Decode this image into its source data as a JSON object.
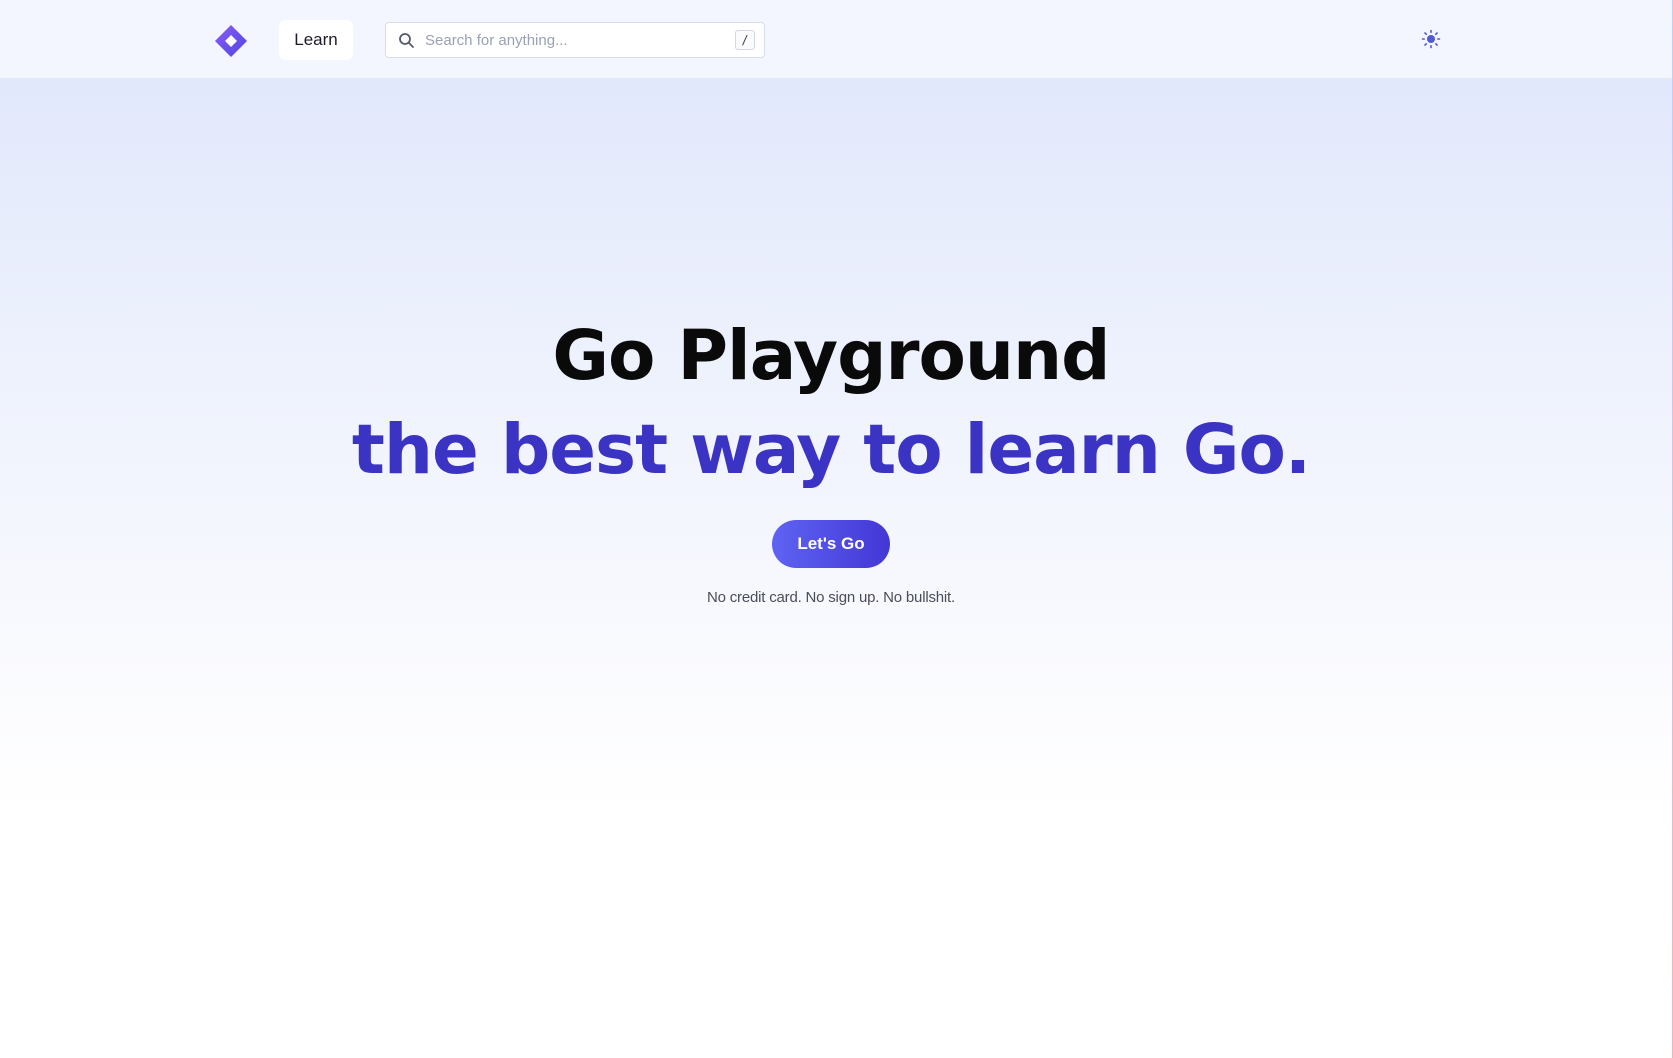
{
  "header": {
    "logo_icon": "diamond-logo-icon",
    "nav": [
      {
        "label": "Learn"
      }
    ],
    "search": {
      "placeholder": "Search for anything...",
      "value": "",
      "shortcut": "/"
    },
    "theme_toggle_icon": "sun-icon"
  },
  "hero": {
    "title": "Go Playground",
    "subtitle": "the best way to learn Go.",
    "cta_label": "Let's Go",
    "tagline": "No credit card. No sign up. No bullshit."
  },
  "colors": {
    "brand": "#6e56f0",
    "accent": "#3a33c4",
    "button_gradient_start": "#5f63f2",
    "button_gradient_end": "#4337d6"
  }
}
